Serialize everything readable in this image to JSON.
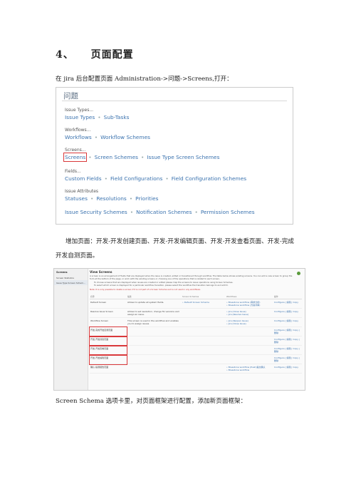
{
  "heading": {
    "number": "4、",
    "title": "页面配置"
  },
  "para1": "在 jira 后台配置页面 Administration->问题->Screens,打开：",
  "panel": {
    "title": "问题",
    "groups": [
      {
        "label": "Issue Types...",
        "links": [
          "Issue Types",
          "Sub-Tasks"
        ]
      },
      {
        "label": "Workflows...",
        "links": [
          "Workflows",
          "Workflow Schemes"
        ]
      },
      {
        "label": "Screens...",
        "links": [
          "Screens",
          "Screen Schemes",
          "Issue Type Screen Schemes"
        ]
      },
      {
        "label": "Fields...",
        "links": [
          "Custom Fields",
          "Field Configurations",
          "Field Configuration Schemes"
        ]
      },
      {
        "label": "Issue Attributes",
        "links": [
          "Statuses",
          "Resolutions",
          "Priorities"
        ]
      },
      {
        "label": "",
        "links": [
          "Issue Security Schemes",
          "Notification Schemes",
          "Permission Schemes"
        ]
      }
    ],
    "separator": "•"
  },
  "para2_line1": "增加页面：开发-开发创建页面、开发-开发编辑页面、开发-开发查看页面、开发-完成",
  "para2_line2": "开发自测页面。",
  "shot": {
    "sidebar_header": "Screens",
    "sidebar_items": [
      "Screen Statistics",
      "Issue Type Screen Schem..."
    ],
    "title": "View Screens",
    "description": "A screen is an arrangement of fields that are displayed when the issue is created, edited or transitioned through workflow. The table below shows existing screens. You can add a new screen to group the form at the bottom of the page, or work with the existing screens or choosing one of the operations that is related to each screen.",
    "bullet1": "To choose screens that are displayed when issues are created or edited please map the screens to issue operations using Screen Schemes.",
    "bullet2": "To select which screen is displayed for a particular workflow transition, please select the workflow the transition belongs to and edit it.",
    "note": "Note: It is only possible to delete a screen if it is not part of a Screen Scheme and is not used in any workflows.",
    "columns": [
      "名称",
      "描述",
      "Screen Schemes",
      "Workflows",
      "操作"
    ],
    "rows": [
      {
        "name": "Default Screen",
        "desc": "Allows to update all system fields.",
        "schemes": "• Default Screen Scheme",
        "workflows": "• Bluestone workflow (需求分析)\n• Bluestone workflow (方案评审)",
        "ops": "Configure | 编辑 | Copy"
      },
      {
        "name": "Resolve Issue Screen",
        "desc": "Allows to set resolution, change fix versions and assign an issue.",
        "schemes": "",
        "workflows": "• jira (Close Issue)\n• jira (Resolve Issue)",
        "ops": "Configure | 编辑 | Copy"
      },
      {
        "name": "Workflow Screen",
        "desc": "This screen is used in the workflow and enables you to assign issues",
        "schemes": "",
        "workflows": "• jira (Reopen Issue)\n• jira (Close Issue)",
        "ops": "Configure | 编辑 | Copy"
      },
      {
        "name": "开发-完成开发自测页面",
        "desc": "",
        "schemes": "",
        "workflows": "",
        "ops": "Configure | 编辑 | Copy | 删除",
        "red": true
      },
      {
        "name": "开发-开发创建页面",
        "desc": "",
        "schemes": "",
        "workflows": "",
        "ops": "Configure | 编辑 | Copy | 删除",
        "red": true
      },
      {
        "name": "开发-开发查看页面",
        "desc": "",
        "schemes": "",
        "workflows": "",
        "ops": "Configure | 编辑 | Copy | 删除",
        "red": true
      },
      {
        "name": "开发-开发编辑页面",
        "desc": "",
        "schemes": "",
        "workflows": "",
        "ops": "Configure | 编辑 | Copy | 删除",
        "red": true
      },
      {
        "name": "确认-提测报告页面",
        "desc": "",
        "schemes": "",
        "workflows": "• Bluestone workflow (Push)提交确认\n• Bluestone workflow",
        "ops": "Configure | 编辑 | Copy"
      }
    ]
  },
  "para3": "Screen Schema 选项卡里，对页面框架进行配置，添加新页面框架："
}
